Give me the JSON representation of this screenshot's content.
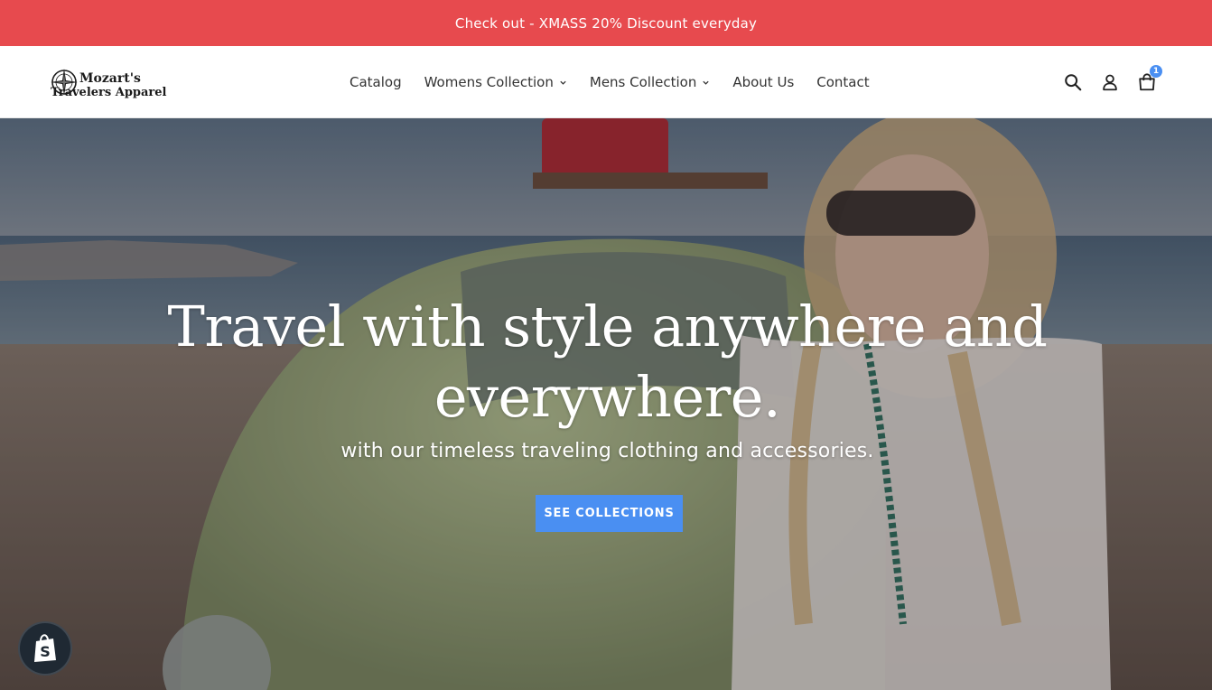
{
  "announcement": {
    "text": "Check out - XMASS 20% Discount everyday"
  },
  "header": {
    "logo": {
      "line1": "Mozart's",
      "line2": "Travelers Apparel"
    },
    "nav": [
      {
        "label": "Catalog",
        "dropdown": false
      },
      {
        "label": "Womens Collection",
        "dropdown": true
      },
      {
        "label": "Mens Collection",
        "dropdown": true
      },
      {
        "label": "About Us",
        "dropdown": false
      },
      {
        "label": "Contact",
        "dropdown": false
      }
    ],
    "tools": {
      "search_icon": "search-icon",
      "account_icon": "account-icon",
      "cart_icon": "cart-icon",
      "cart_count": "1"
    }
  },
  "hero": {
    "title": "Travel with style anywhere and everywhere.",
    "subtitle": "with our timeless traveling clothing and accessories.",
    "button_label": "SEE COLLECTIONS"
  },
  "shop_badge": {
    "icon": "shopify-icon"
  },
  "colors": {
    "announcement_bg": "#e74a4e",
    "accent": "#4a8ff2",
    "badge_bg": "#1f2933"
  }
}
